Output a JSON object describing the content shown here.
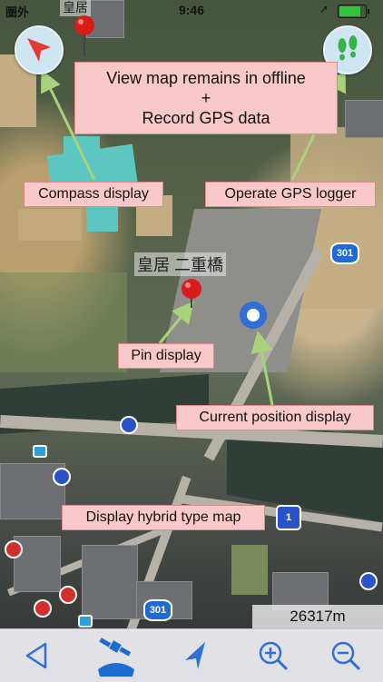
{
  "status_bar": {
    "carrier": "圏外",
    "time": "9:46",
    "battery_level": 0.9
  },
  "map": {
    "labels": {
      "area_top": "皇居",
      "palace_bridge": "皇居 二重橋"
    },
    "route_shields": [
      "301",
      "301",
      "1"
    ]
  },
  "buttons": {
    "compass": {
      "icon": "compass-arrow-icon",
      "color": "#e53935"
    },
    "gps_logger": {
      "icon": "footprints-icon",
      "color": "#36b34a"
    }
  },
  "callouts": {
    "offline": {
      "line1": "View map remains in offline",
      "line2": "+",
      "line3": "Record GPS data"
    },
    "compass": "Compass display",
    "gps_logger": "Operate GPS logger",
    "pin": "Pin display",
    "current_position": "Current position display",
    "hybrid": "Display hybrid type map"
  },
  "scale": {
    "value": "26317m"
  },
  "toolbar": {
    "items": [
      {
        "icon": "back-triangle-icon"
      },
      {
        "icon": "satellite-map-icon"
      },
      {
        "icon": "navigation-arrow-icon"
      },
      {
        "icon": "zoom-in-icon"
      },
      {
        "icon": "zoom-out-icon"
      }
    ]
  },
  "colors": {
    "callout_bg": "#f9c8c8",
    "pointer_line": "#a8d37a",
    "pin": "#d81b1b",
    "current_position": "#2f6fd6",
    "toolbar_icon": "#2f6fd6"
  }
}
